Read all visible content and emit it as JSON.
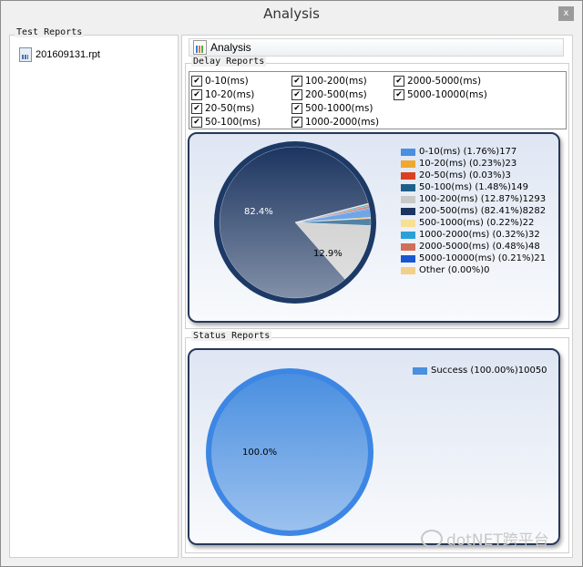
{
  "window": {
    "title": "Analysis",
    "close_label": "x"
  },
  "test_reports": {
    "label": "Test Reports",
    "files": [
      "201609131.rpt"
    ]
  },
  "analysis_tab": {
    "label": "Analysis"
  },
  "delay_reports": {
    "label": "Delay  Reports",
    "checkboxes": [
      {
        "label": "0-10(ms)",
        "checked": true
      },
      {
        "label": "10-20(ms)",
        "checked": true
      },
      {
        "label": "20-50(ms)",
        "checked": true
      },
      {
        "label": "50-100(ms)",
        "checked": true
      },
      {
        "label": "100-200(ms)",
        "checked": true
      },
      {
        "label": "200-500(ms)",
        "checked": true
      },
      {
        "label": "500-1000(ms)",
        "checked": true
      },
      {
        "label": "1000-2000(ms)",
        "checked": true
      },
      {
        "label": "2000-5000(ms)",
        "checked": true
      },
      {
        "label": "5000-10000(ms)",
        "checked": true
      }
    ],
    "check_glyph": "✔"
  },
  "status_reports": {
    "label": "Status Reports"
  },
  "watermark": {
    "text": "dotNET跨平台"
  },
  "chart_data": [
    {
      "type": "pie",
      "slice_labels": [
        "82.4%",
        "12.9%"
      ],
      "legend_position": "right",
      "series": [
        {
          "name": "0-10(ms) (1.76%)177",
          "value": 177,
          "color": "#4a8fe0"
        },
        {
          "name": "10-20(ms) (0.23%)23",
          "value": 23,
          "color": "#f0a830"
        },
        {
          "name": "20-50(ms) (0.03%)3",
          "value": 3,
          "color": "#d94020"
        },
        {
          "name": "50-100(ms) (1.48%)149",
          "value": 149,
          "color": "#1f5f8a"
        },
        {
          "name": "100-200(ms) (12.87%)1293",
          "value": 1293,
          "color": "#c8c8c8"
        },
        {
          "name": "200-500(ms) (82.41%)8282",
          "value": 8282,
          "color": "#1c3560"
        },
        {
          "name": "500-1000(ms) (0.22%)22",
          "value": 22,
          "color": "#f7df94"
        },
        {
          "name": "1000-2000(ms) (0.32%)32",
          "value": 32,
          "color": "#2aa0d8"
        },
        {
          "name": "2000-5000(ms) (0.48%)48",
          "value": 48,
          "color": "#d0705a"
        },
        {
          "name": "5000-10000(ms) (0.21%)21",
          "value": 21,
          "color": "#1a56d0"
        },
        {
          "name": "Other (0.00%)0",
          "value": 0,
          "color": "#f2cf8a"
        }
      ]
    },
    {
      "type": "pie",
      "slice_labels": [
        "100.0%"
      ],
      "legend_position": "top-right",
      "series": [
        {
          "name": "Success (100.00%)10050",
          "value": 10050,
          "color": "#4a8fe0"
        }
      ]
    }
  ]
}
